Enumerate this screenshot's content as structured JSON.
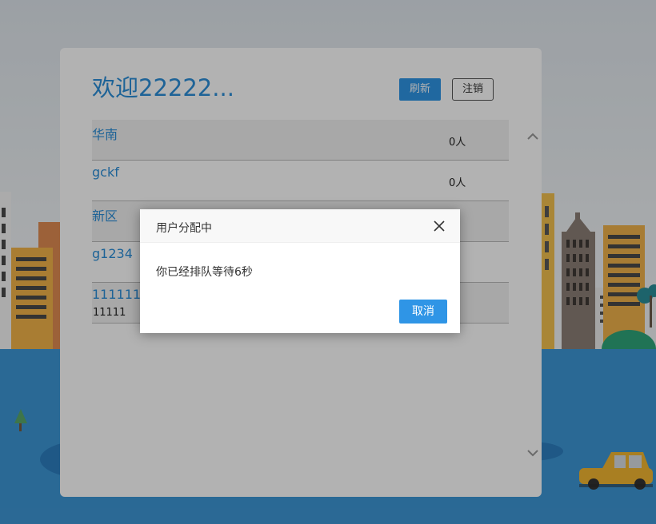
{
  "header": {
    "title": "欢迎22222...",
    "refresh_label": "刷新",
    "logout_label": "注销"
  },
  "rooms": [
    {
      "name": "华南",
      "sub": "",
      "count": "0人"
    },
    {
      "name": "gckf",
      "sub": "",
      "count": "0人"
    },
    {
      "name": "新区",
      "sub": "",
      "count": "人"
    },
    {
      "name": "g1234",
      "sub": "",
      "count": "人"
    },
    {
      "name": "1111111",
      "sub": "11111",
      "count": "人"
    }
  ],
  "dialog": {
    "title": "用户分配中",
    "message": "你已经排队等待6秒",
    "cancel_label": "取消"
  },
  "icons": {
    "close": "close-icon",
    "scroll_up": "chevron-up-icon",
    "scroll_down": "chevron-down-icon"
  },
  "colors": {
    "accent": "#2f95e6",
    "link": "#2b8fd8",
    "water": "#3d97d6"
  }
}
